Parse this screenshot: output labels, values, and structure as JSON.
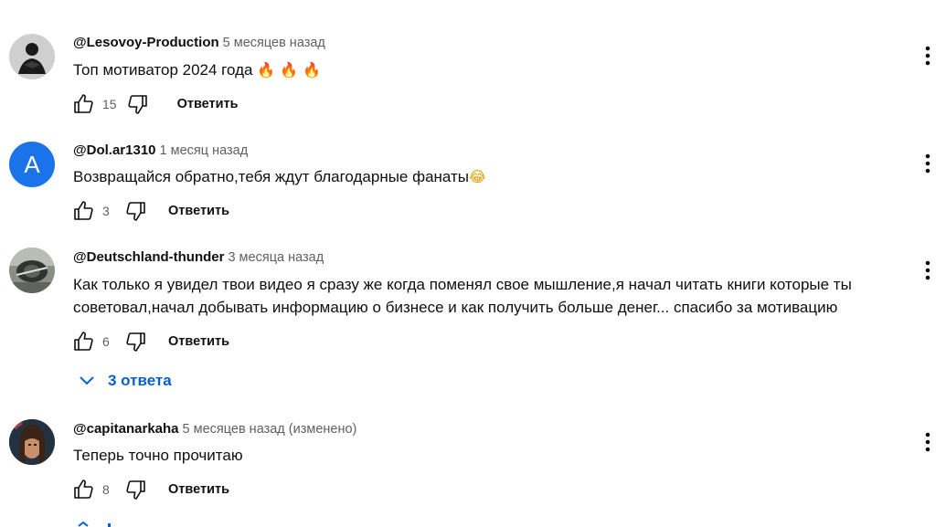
{
  "comments": [
    {
      "author": "@Lesovoy-Production",
      "time": "5 месяцев назад",
      "text": "Топ мотиватор 2024 года",
      "emoji": "🔥 🔥 🔥",
      "likes": "15",
      "reply_label": "Ответить"
    },
    {
      "author": "@Dol.ar1310",
      "time": "1 месяц назад",
      "avatar_letter": "A",
      "text": "Возвращайся обратно,тебя ждут благодарные фанаты",
      "emoji": "😂",
      "likes": "3",
      "reply_label": "Ответить"
    },
    {
      "author": "@Deutschland-thunder",
      "time": "3 месяца назад",
      "text_line1": "Как только я увидел твои видео я сразу же когда поменял свое мышление,я начал читать книги которые ты",
      "text_line2": "советовал,начал добывать информацию о бизнесе и как получить больше денег... спасибо за мотивацию",
      "likes": "6",
      "reply_label": "Ответить",
      "replies_label": "3 ответа"
    },
    {
      "author": "@capitanarkaha",
      "time": "5 месяцев назад (изменено)",
      "text": "Теперь точно прочитаю",
      "likes": "8",
      "reply_label": "Ответить"
    }
  ],
  "colors": {
    "link_blue": "#065fd4",
    "avatar_blue": "#1a73e8",
    "secondary_text": "#606060"
  },
  "icons": {
    "like": "thumbs-up-icon",
    "dislike": "thumbs-down-icon",
    "menu": "more-vert-icon",
    "replies": "chevron-down-icon"
  }
}
